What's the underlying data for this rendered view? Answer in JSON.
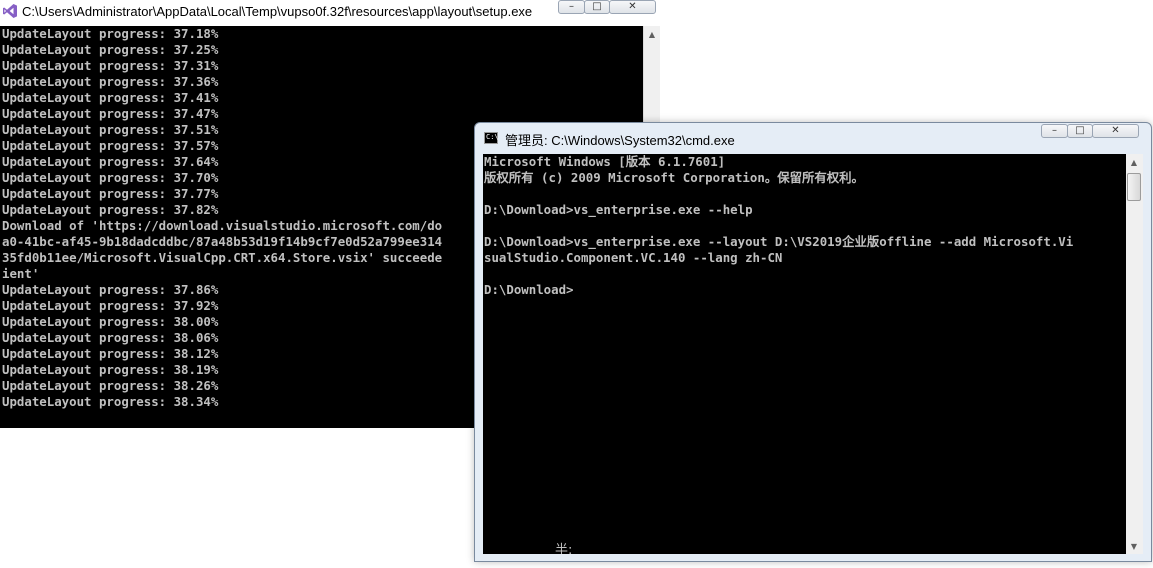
{
  "back_window": {
    "title": "C:\\Users\\Administrator\\AppData\\Local\\Temp\\vupso0f.32f\\resources\\app\\layout\\setup.exe",
    "icon": "visual-studio-icon",
    "controls": {
      "minimize": "–",
      "maximize": "□",
      "close": "✕"
    },
    "lines": [
      "UpdateLayout progress: 37.18%",
      "UpdateLayout progress: 37.25%",
      "UpdateLayout progress: 37.31%",
      "UpdateLayout progress: 37.36%",
      "UpdateLayout progress: 37.41%",
      "UpdateLayout progress: 37.47%",
      "UpdateLayout progress: 37.51%",
      "UpdateLayout progress: 37.57%",
      "UpdateLayout progress: 37.64%",
      "UpdateLayout progress: 37.70%",
      "UpdateLayout progress: 37.77%",
      "UpdateLayout progress: 37.82%",
      "Download of 'https://download.visualstudio.microsoft.com/do",
      "a0-41bc-af45-9b18dadcddbc/87a48b53d19f14b9cf7e0d52a799ee314",
      "35fd0b11ee/Microsoft.VisualCpp.CRT.x64.Store.vsix' succeede",
      "ient'",
      "UpdateLayout progress: 37.86%",
      "UpdateLayout progress: 37.92%",
      "UpdateLayout progress: 38.00%",
      "UpdateLayout progress: 38.06%",
      "UpdateLayout progress: 38.12%",
      "UpdateLayout progress: 38.19%",
      "UpdateLayout progress: 38.26%",
      "UpdateLayout progress: 38.34%"
    ]
  },
  "front_window": {
    "title": "管理员: C:\\Windows\\System32\\cmd.exe",
    "icon": "cmd-icon",
    "controls": {
      "minimize": "–",
      "maximize": "□",
      "close": "✕"
    },
    "lines": [
      "Microsoft Windows [版本 6.1.7601]",
      "版权所有 (c) 2009 Microsoft Corporation。保留所有权利。",
      "",
      "D:\\Download>vs_enterprise.exe --help",
      "",
      "D:\\Download>vs_enterprise.exe --layout D:\\VS2019企业版offline --add Microsoft.Vi",
      "sualStudio.Component.VC.140 --lang zh-CN",
      "",
      "D:\\Download>"
    ],
    "ime_status": "半:"
  },
  "scrollbar_arrows": {
    "up": "▲",
    "down": "▼"
  }
}
